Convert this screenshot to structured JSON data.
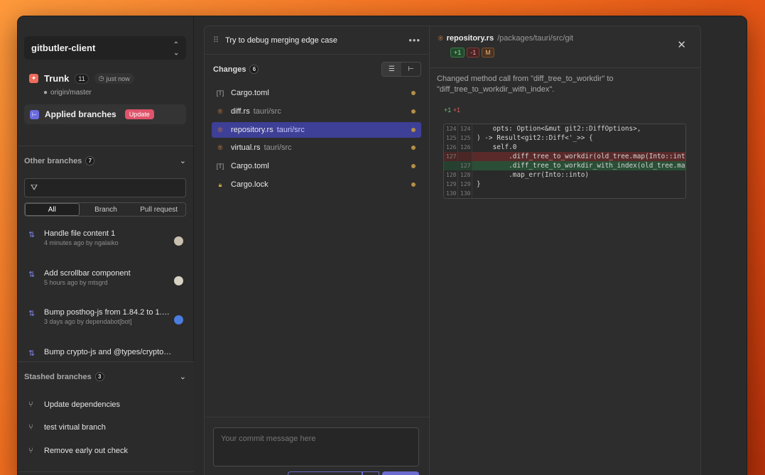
{
  "sidebar": {
    "project": "gitbutler-client",
    "trunk": {
      "label": "Trunk",
      "count": "11",
      "time": "just now",
      "remote": "origin/master"
    },
    "applied": {
      "label": "Applied branches",
      "badge": "Update"
    },
    "other": {
      "label": "Other branches",
      "count": "7",
      "segments": [
        "All",
        "Branch",
        "Pull request"
      ],
      "items": [
        {
          "title": "Handle file content 1",
          "sub": "4 minutes ago by ngalaiko"
        },
        {
          "title": "Add scrollbar component",
          "sub": "5 hours ago by mtsgrd"
        },
        {
          "title": "Bump posthog-js from 1.84.2 to 1.9…",
          "sub": "3 days ago by dependabot[bot]"
        },
        {
          "title": "Bump crypto-js and @types/crypto…",
          "sub": ""
        }
      ]
    },
    "stashed": {
      "label": "Stashed branches",
      "count": "3",
      "items": [
        "Update dependencies",
        "test virtual branch",
        "Remove early out check"
      ]
    }
  },
  "lane": {
    "title": "Try to debug merging edge case",
    "changes_label": "Changes",
    "changes_count": "6",
    "files": [
      {
        "icon": "toml-file-icon",
        "name": "Cargo.toml",
        "path": ""
      },
      {
        "icon": "rust-file-icon",
        "name": "diff.rs",
        "path": "tauri/src"
      },
      {
        "icon": "rust-file-icon",
        "name": "repository.rs",
        "path": "tauri/src"
      },
      {
        "icon": "rust-file-icon",
        "name": "virtual.rs",
        "path": "tauri/src"
      },
      {
        "icon": "toml-file-icon",
        "name": "Cargo.toml",
        "path": ""
      },
      {
        "icon": "lock-file-icon",
        "name": "Cargo.lock",
        "path": ""
      }
    ],
    "commit_placeholder": "Your commit message here"
  },
  "diff": {
    "file_name": "repository.rs",
    "file_path": "/packages/tauri/src/git",
    "badges": {
      "added": "+1",
      "removed": "-1",
      "status": "M"
    },
    "description": "Changed method call from \"diff_tree_to_workdir\" to \"diff_tree_to_workdir_with_index\".",
    "hunk_added": "+1",
    "hunk_removed": "+1",
    "lines": [
      {
        "old": "124",
        "new": "124",
        "type": "ctx",
        "text": "    opts: Option<&mut git2::DiffOptions>,"
      },
      {
        "old": "125",
        "new": "125",
        "type": "ctx",
        "text": ") -> Result<git2::Diff<'_>> {"
      },
      {
        "old": "126",
        "new": "126",
        "type": "ctx",
        "text": "    self.0"
      },
      {
        "old": "127",
        "new": "",
        "type": "del",
        "text": "        .diff_tree_to_workdir(old_tree.map(Into::into"
      },
      {
        "old": "",
        "new": "127",
        "type": "add",
        "text": "        .diff_tree_to_workdir_with_index(old_tree.ma"
      },
      {
        "old": "128",
        "new": "128",
        "type": "ctx",
        "text": "        .map_err(Into::into)"
      },
      {
        "old": "129",
        "new": "129",
        "type": "ctx",
        "text": "}"
      },
      {
        "old": "130",
        "new": "130",
        "type": "ctx",
        "text": ""
      }
    ]
  },
  "colors": {
    "accent": "#6c6ccf",
    "selected_row": "#3e3f96",
    "update_badge": "#e0536b",
    "modified_dot": "#b58f48"
  }
}
